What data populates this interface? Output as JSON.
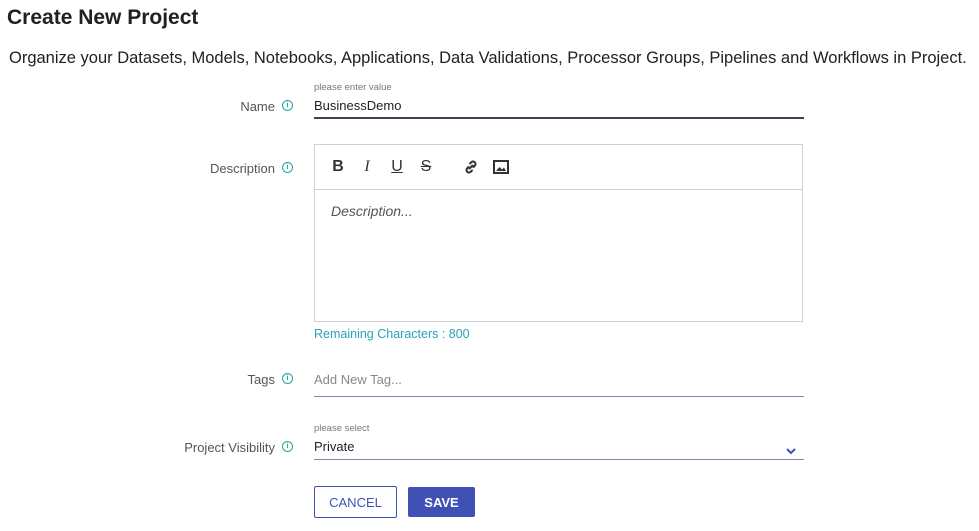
{
  "page": {
    "title": "Create New Project",
    "subtitle": "Organize your Datasets, Models, Notebooks, Applications, Data Validations, Processor Groups, Pipelines and Workflows in Project."
  },
  "form": {
    "name": {
      "label": "Name",
      "hint": "please enter value",
      "value": "BusinessDemo"
    },
    "description": {
      "label": "Description",
      "placeholder": "Description...",
      "remaining": "Remaining Characters : 800",
      "toolbar": [
        "bold-icon",
        "italic-icon",
        "underline-icon",
        "strikethrough-icon",
        "link-icon",
        "image-icon"
      ]
    },
    "tags": {
      "label": "Tags",
      "placeholder": "Add New Tag..."
    },
    "visibility": {
      "label": "Project Visibility",
      "hint": "please select",
      "value": "Private"
    }
  },
  "actions": {
    "cancel": "CANCEL",
    "save": "SAVE"
  },
  "colors": {
    "accent": "#3f51b5",
    "info": "#2aa39a",
    "remaining": "#2aa3b5"
  }
}
